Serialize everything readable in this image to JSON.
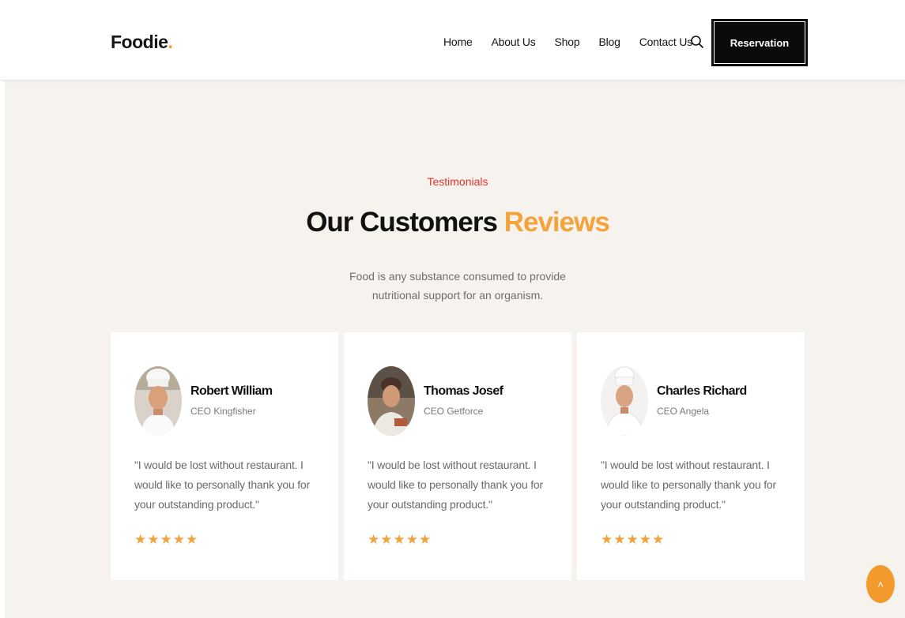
{
  "header": {
    "logo_text": "Foodie",
    "logo_dot": ".",
    "nav": [
      "Home",
      "About Us",
      "Shop",
      "Blog",
      "Contact Us"
    ],
    "search_icon": "search-icon",
    "reservation_label": "Reservation"
  },
  "section": {
    "eyebrow": "Testimonials",
    "title_main": "Our Customers ",
    "title_accent": "Reviews",
    "subtitle": "Food is any substance consumed to provide nutritional support for an organism."
  },
  "testimonials": [
    {
      "name": "Robert William",
      "role": "CEO Kingfisher",
      "quote": "\"I would be lost without restaurant. I would like to personally thank you for your outstanding product.\"",
      "stars": "★★★★★"
    },
    {
      "name": "Thomas Josef",
      "role": "CEO Getforce",
      "quote": "\"I would be lost without restaurant. I would like to personally thank you for your outstanding product.\"",
      "stars": "★★★★★"
    },
    {
      "name": "Charles Richard",
      "role": "CEO Angela",
      "quote": "\"I would be lost without restaurant. I would like to personally thank you for your outstanding product.\"",
      "stars": "★★★★★"
    }
  ],
  "scroll_top_glyph": "˄",
  "colors": {
    "accent_orange": "#f3a33a",
    "eyebrow_red": "#e0322d",
    "button_dark": "#0b0b0b",
    "background": "#f6f3ee"
  }
}
